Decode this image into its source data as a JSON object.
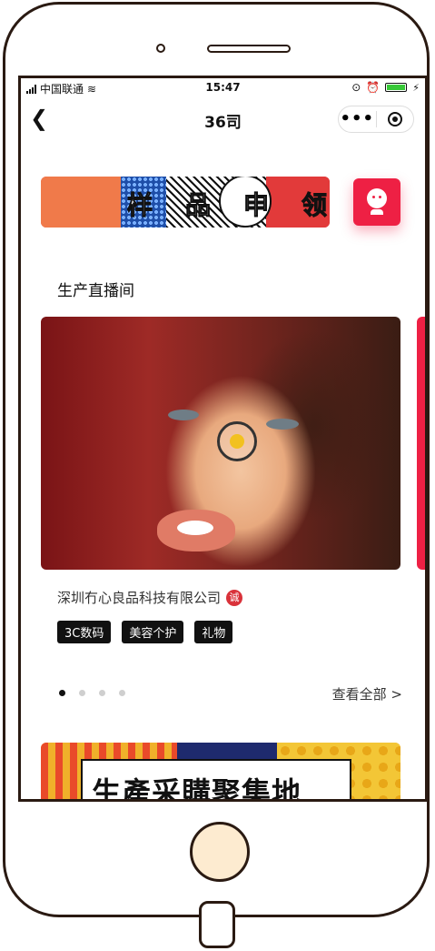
{
  "status_bar": {
    "carrier": "中国联通",
    "time": "15:47",
    "battery_color": "#37c837"
  },
  "nav": {
    "title": "36司",
    "more_label": "•••",
    "back_icon": "chevron-left-icon",
    "close_icon": "target-icon"
  },
  "banner": {
    "characters": [
      "样",
      "品",
      "申",
      "领"
    ]
  },
  "section": {
    "title": "生产直播间"
  },
  "live_card": {
    "company": "深圳冇心良品科技有限公司",
    "verified_badge": "诚",
    "tags": [
      "3C数码",
      "美容个护",
      "礼物"
    ],
    "carousel_total": 4,
    "carousel_active": 0,
    "view_all": "查看全部 >"
  },
  "bottom_banner": {
    "text": "生產采購聚集地"
  },
  "colors": {
    "accent": "#ee2044",
    "tag_bg": "#111111"
  }
}
